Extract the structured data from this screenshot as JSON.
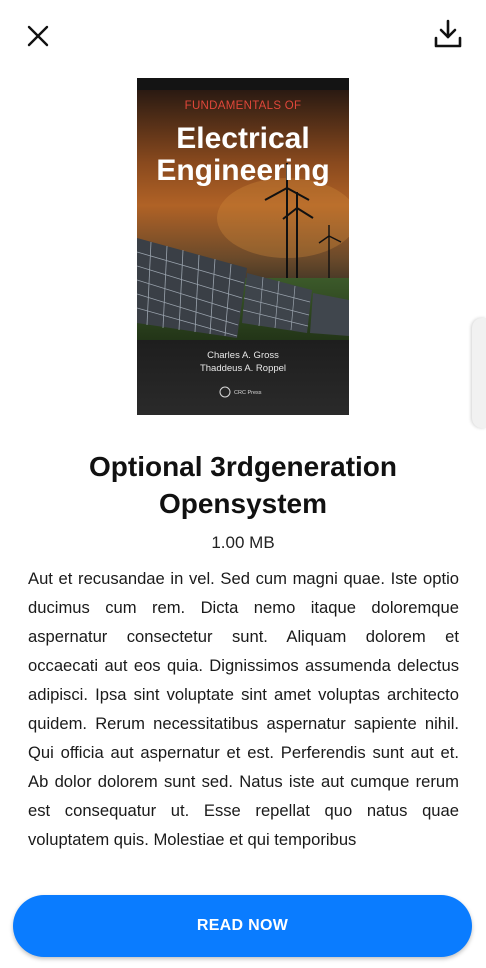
{
  "header": {
    "close_icon": "close-icon",
    "download_icon": "download-icon"
  },
  "book": {
    "cover": {
      "top_line": "FUNDAMENTALS OF",
      "title_line1": "Electrical",
      "title_line2": "Engineering",
      "author1": "Charles A. Gross",
      "author2": "Thaddeus A. Roppel",
      "publisher": "CRC Press"
    },
    "title": "Optional 3rdgeneration Opensystem",
    "size": "1.00 MB",
    "description": "Aut et recusandae in vel. Sed cum magni quae. Iste optio ducimus cum rem. Dicta nemo itaque doloremque aspernatur consectetur sunt. Aliquam dolorem et occaecati aut eos quia. Dignissimos assumenda delectus adipisci. Ipsa sint voluptate sint amet voluptas architecto quidem. Rerum necessitatibus aspernatur sapiente nihil. Qui officia aut aspernatur et est. Perferendis sunt aut et. Ab dolor dolorem sunt sed. Natus iste aut cumque rerum est consequatur ut. Esse repellat quo natus quae voluptatem quis. Molestiae et qui temporibus"
  },
  "actions": {
    "read_label": "READ NOW"
  },
  "colors": {
    "accent": "#0a7cff",
    "cover_red": "#e0473a"
  }
}
